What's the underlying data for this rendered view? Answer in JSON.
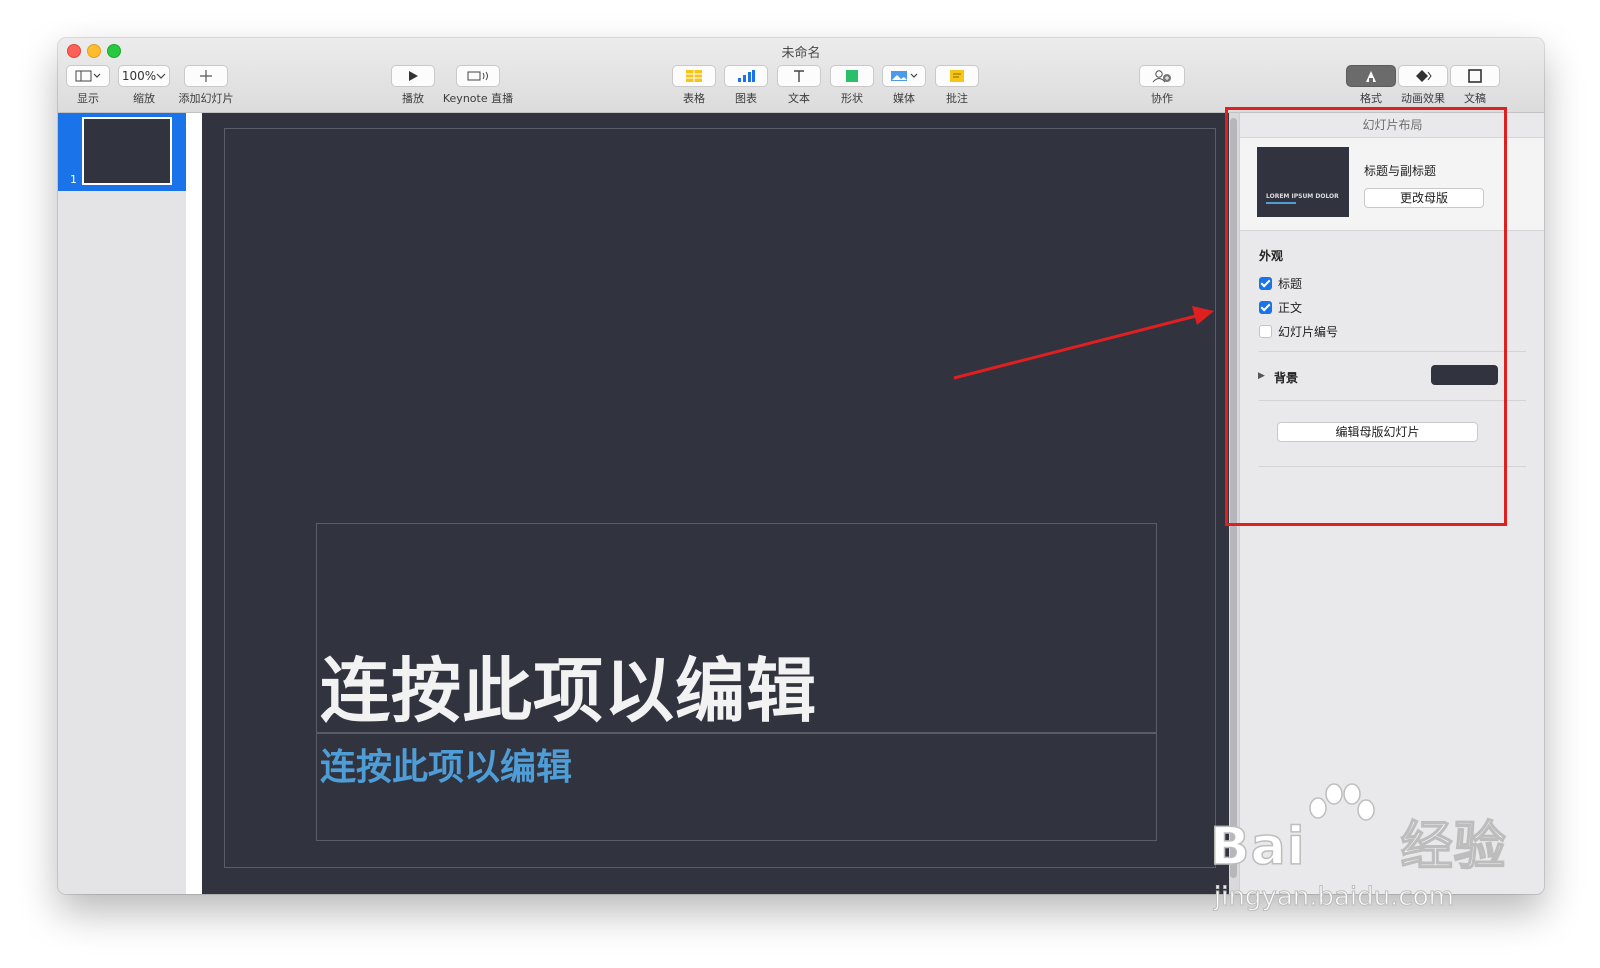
{
  "window": {
    "title": "未命名"
  },
  "toolbar": {
    "view": {
      "label": "显示"
    },
    "zoom": {
      "value": "100%",
      "label": "缩放"
    },
    "add_slide": {
      "label": "添加幻灯片"
    },
    "play": {
      "label": "播放"
    },
    "keynote_live": {
      "label": "Keynote 直播"
    },
    "table": {
      "label": "表格"
    },
    "chart": {
      "label": "图表"
    },
    "text": {
      "label": "文本"
    },
    "shape": {
      "label": "形状"
    },
    "media": {
      "label": "媒体"
    },
    "comment": {
      "label": "批注"
    },
    "collaborate": {
      "label": "协作"
    },
    "format": {
      "label": "格式"
    },
    "animate": {
      "label": "动画效果"
    },
    "document": {
      "label": "文稿"
    }
  },
  "navigator": {
    "slide_number": "1"
  },
  "slide": {
    "title": "连按此项以编辑",
    "subtitle": "连按此项以编辑",
    "background_color": "#31333f",
    "subtitle_color": "#4f9dd6"
  },
  "inspector": {
    "header": "幻灯片布局",
    "master_name": "标题与副标题",
    "master_thumb_text": "LOREM IPSUM DOLOR",
    "change_master_button": "更改母版",
    "appearance_title": "外观",
    "checkboxes": [
      {
        "label": "标题",
        "checked": true
      },
      {
        "label": "正文",
        "checked": true
      },
      {
        "label": "幻灯片编号",
        "checked": false
      }
    ],
    "background_label": "背景",
    "edit_master_button": "编辑母版幻灯片"
  },
  "annotation": {
    "highlight_color": "#e02020"
  },
  "watermark": {
    "brand": "Bai",
    "brand_suffix": "经验",
    "url": "jingyan.baidu.com"
  }
}
